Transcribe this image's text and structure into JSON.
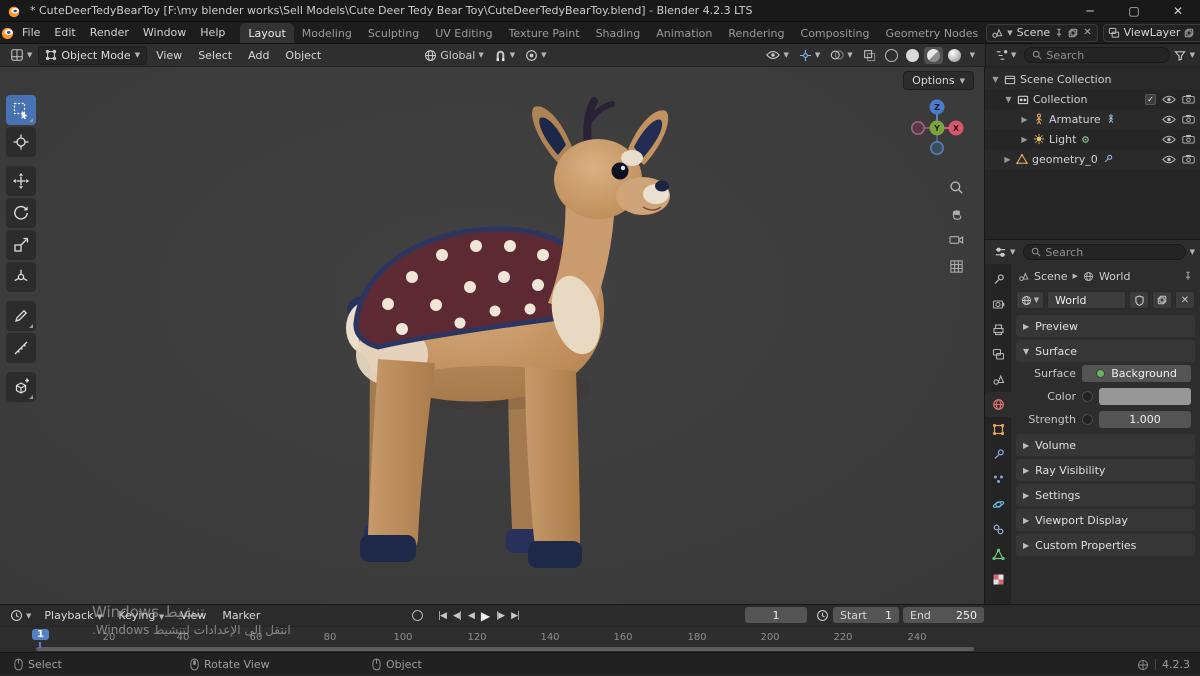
{
  "colors": {
    "accent": "#4772b3",
    "object_orange": "#e8a35f",
    "world_red": "#d97070",
    "viewport_bg": "#3a3a3a"
  },
  "titlebar": {
    "title": "* CuteDeerTedyBearToy [F:\\my blender works\\Sell Models\\Cute Deer Tedy Bear Toy\\CuteDeerTedyBearToy.blend] - Blender 4.2.3 LTS"
  },
  "menubar": {
    "menus": [
      "File",
      "Edit",
      "Render",
      "Window",
      "Help"
    ],
    "workspaces": [
      "Layout",
      "Modeling",
      "Sculpting",
      "UV Editing",
      "Texture Paint",
      "Shading",
      "Animation",
      "Rendering",
      "Compositing",
      "Geometry Nodes"
    ],
    "scene_label": "Scene",
    "viewlayer_label": "ViewLayer"
  },
  "toolheader": {
    "mode": "Object Mode",
    "menus": [
      "View",
      "Select",
      "Add",
      "Object"
    ],
    "orientation": "Global",
    "options": "Options"
  },
  "outliner": {
    "search_placeholder": "Search",
    "rows": [
      {
        "label": "Scene Collection"
      },
      {
        "label": "Collection"
      },
      {
        "label": "Armature"
      },
      {
        "label": "Light"
      },
      {
        "label": "geometry_0"
      }
    ]
  },
  "properties": {
    "search_placeholder": "Search",
    "breadcrumb_scene": "Scene",
    "breadcrumb_world": "World",
    "world_name": "World",
    "panels": {
      "preview": "Preview",
      "surface": "Surface",
      "volume": "Volume",
      "ray_visibility": "Ray Visibility",
      "settings": "Settings",
      "viewport_display": "Viewport Display",
      "custom_properties": "Custom Properties"
    },
    "surface": {
      "surface_label": "Surface",
      "surface_value": "Background",
      "color_label": "Color",
      "strength_label": "Strength",
      "strength_value": "1.000"
    }
  },
  "timeline": {
    "menus": [
      "Playback",
      "Keying",
      "View",
      "Marker"
    ],
    "current_frame": "1",
    "playhead": "1",
    "start_label": "Start",
    "start_value": "1",
    "end_label": "End",
    "end_value": "250",
    "ticks": [
      "20",
      "40",
      "60",
      "80",
      "100",
      "120",
      "140",
      "160",
      "180",
      "200",
      "220",
      "240"
    ]
  },
  "statusbar": {
    "items": [
      "Select",
      "Rotate View",
      "Object"
    ],
    "version": "4.2.3"
  },
  "watermark": {
    "line1": "تنشيط Windows",
    "line2": "انتقل إلى الإعدادات لتنشيط Windows."
  },
  "gizmo": {
    "x": "X",
    "y": "Y",
    "z": "Z"
  }
}
